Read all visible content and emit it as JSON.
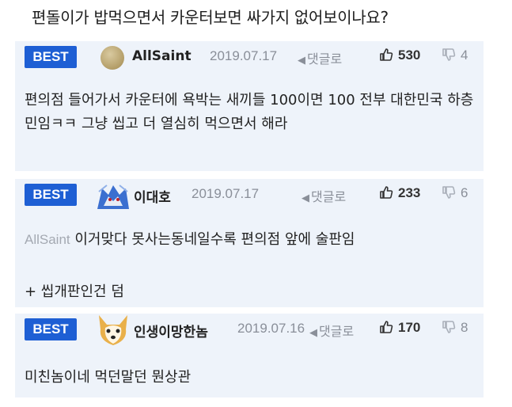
{
  "page": {
    "title": "편돌이가 밥먹으면서 카운터보면 싸가지 없어보이나요?"
  },
  "comments": [
    {
      "badge": "BEST",
      "user": "AllSaint",
      "date": "2019.07.17",
      "reply_label": "댓글로",
      "likes": "530",
      "dislikes": "4",
      "text": "편의점 들어가서 카운터에 욕박는 새끼들 100이면 100 전부 대한민국 하층민임ㅋㅋ 그냥 씹고 더 열심히 먹으면서 해라"
    },
    {
      "badge": "BEST",
      "user": "이대호",
      "date": "2019.07.17",
      "reply_label": "댓글로",
      "likes": "233",
      "dislikes": "6",
      "quote_user": "AllSaint",
      "text": "이거맞다 못사는동네일수록 편의점 앞에 술판임",
      "text2": "+ 씹개판인건 덤"
    },
    {
      "badge": "BEST",
      "user": "인생이망한놈",
      "date": "2019.07.16",
      "reply_label": "댓글로",
      "likes": "170",
      "dislikes": "8",
      "text": "미친놈이네 먹던말던 뭔상관"
    }
  ],
  "colors": {
    "badge": "#1e5fd4",
    "card_bg": "#eef3fa",
    "muted": "#8a8f99"
  }
}
